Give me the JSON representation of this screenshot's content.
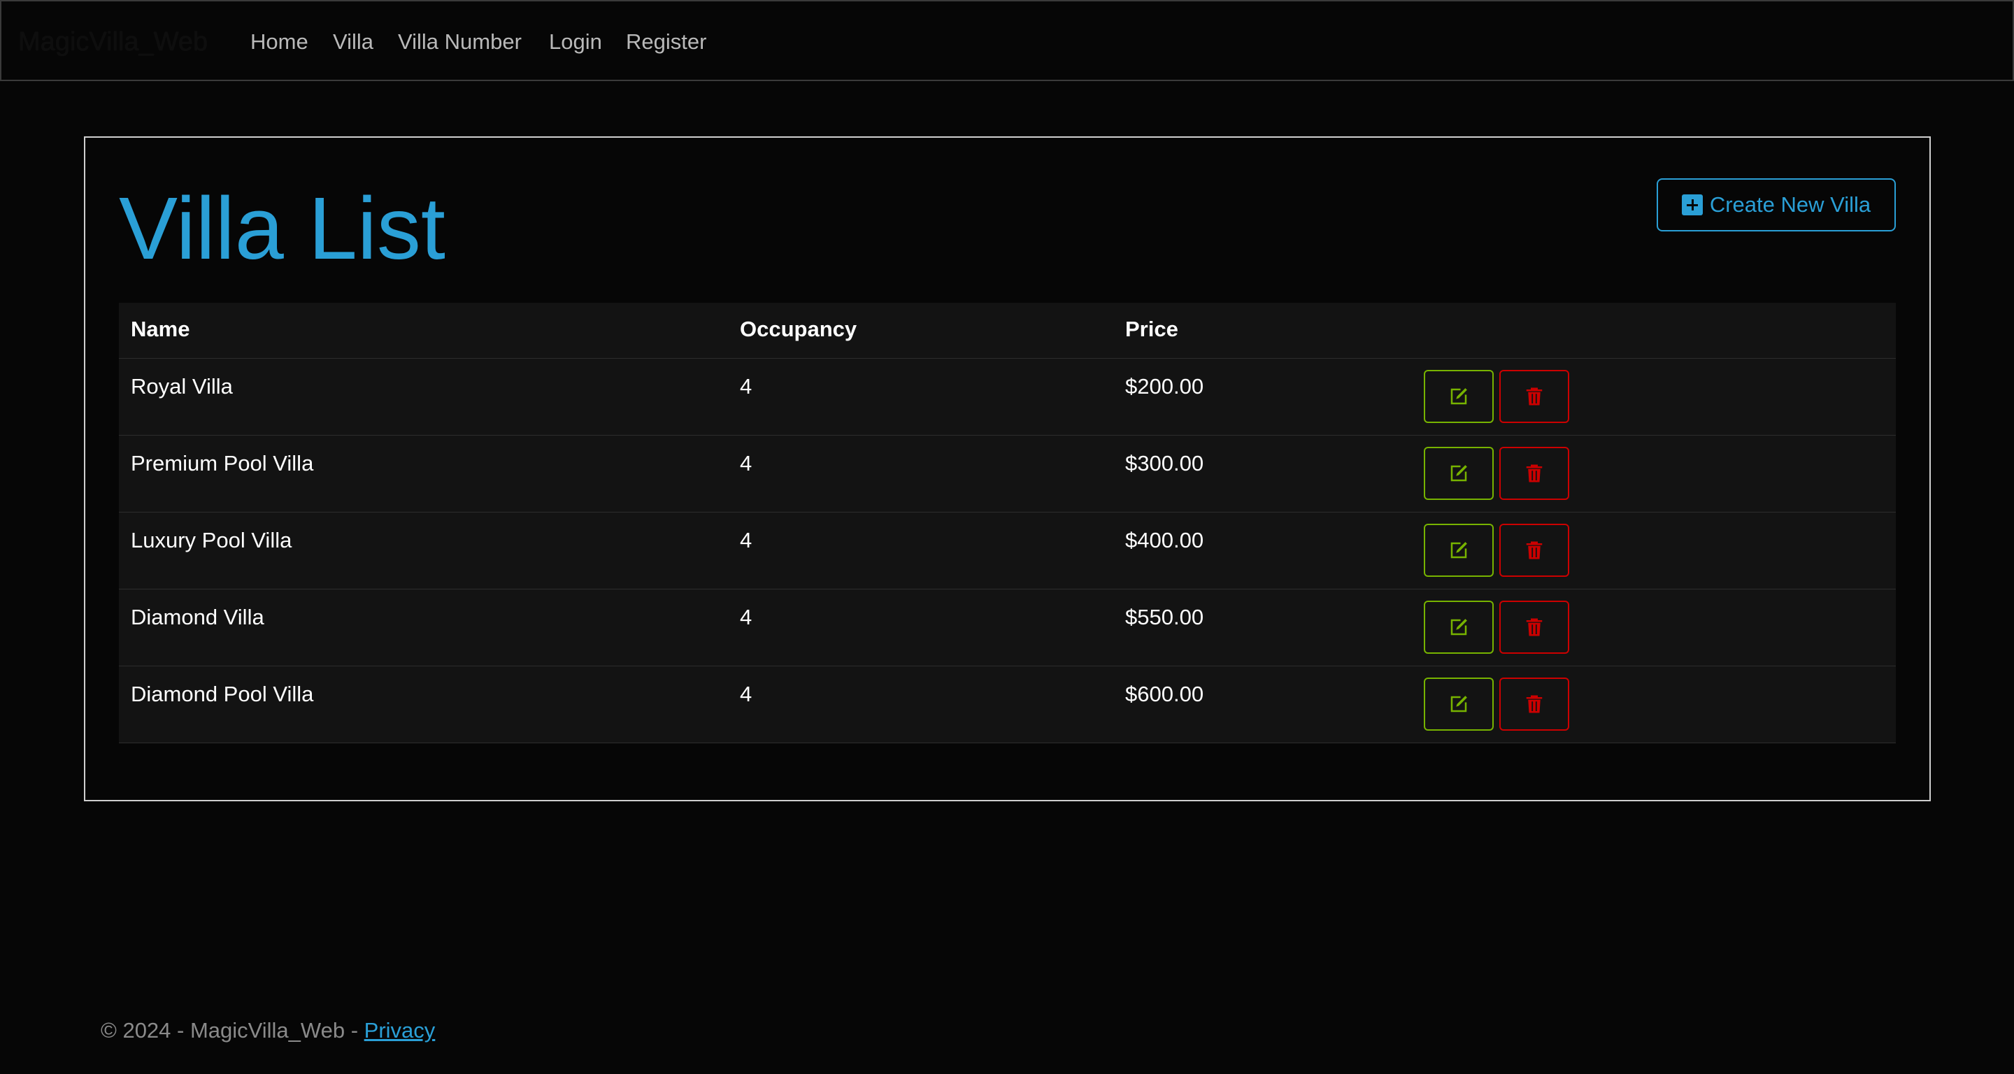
{
  "navbar": {
    "brand": "MagicVilla_Web",
    "items": [
      {
        "label": "Home"
      },
      {
        "label": "Villa"
      },
      {
        "label": "Villa Number"
      },
      {
        "label": "Login"
      },
      {
        "label": "Register"
      }
    ]
  },
  "page": {
    "title": "Villa List",
    "create_button_label": "Create New Villa"
  },
  "table": {
    "columns": [
      "Name",
      "Occupancy",
      "Price",
      ""
    ],
    "rows": [
      {
        "name": "Royal Villa",
        "occupancy": "4",
        "price": "$200.00"
      },
      {
        "name": "Premium Pool Villa",
        "occupancy": "4",
        "price": "$300.00"
      },
      {
        "name": "Luxury Pool Villa",
        "occupancy": "4",
        "price": "$400.00"
      },
      {
        "name": "Diamond Villa",
        "occupancy": "4",
        "price": "$550.00"
      },
      {
        "name": "Diamond Pool Villa",
        "occupancy": "4",
        "price": "$600.00"
      }
    ],
    "row_actions": {
      "edit_icon": "edit-icon",
      "delete_icon": "trash-icon"
    }
  },
  "footer": {
    "text": "© 2024 - MagicVilla_Web - ",
    "privacy_link": "Privacy"
  },
  "colors": {
    "accent": "#2a9fd6",
    "success": "#77b300",
    "danger": "#cc0000",
    "background": "#060606"
  }
}
